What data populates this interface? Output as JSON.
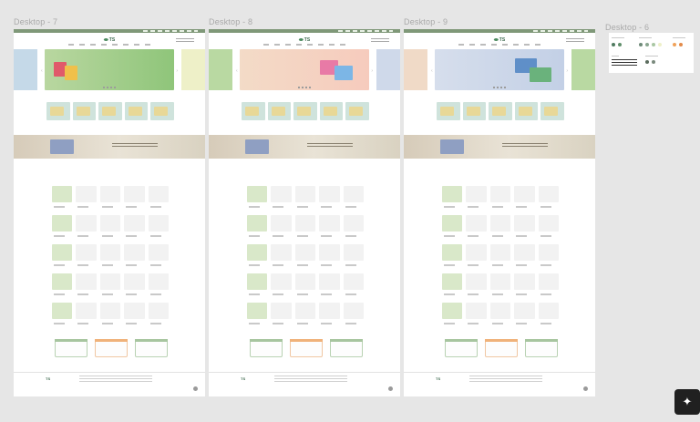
{
  "frames": [
    {
      "label": "Desktop - 7",
      "banner_line1": "",
      "banner_line2": "",
      "banner_bg": "#a8d08a",
      "banner_color": "#7dbb6a",
      "pkg_colors": [
        "#e05a6a",
        "#f0c04a",
        "#5a8bd0"
      ]
    },
    {
      "label": "Desktop - 8",
      "banner_line1": "",
      "banner_line2": "",
      "banner_bg": "#f1d9c4",
      "banner_color": "#f3c8b8",
      "pkg_colors": [
        "#e87aa6",
        "#7cb6e6",
        "#f3c36a"
      ]
    },
    {
      "label": "Desktop - 9",
      "banner_line1": "",
      "banner_line2": "",
      "banner_bg": "#cfd9e8",
      "banner_color": "#b9c8e3",
      "pkg_colors": [
        "#5f8fc8",
        "#6ab27c",
        "#4b6fa8"
      ]
    }
  ],
  "palette_frame": {
    "label": "Desktop - 6",
    "swatches": [
      "#4f7a5f",
      "#5f8f6a",
      "#6e8a78",
      "#8aa690",
      "#a9c7a3",
      "#e0b98a",
      "#f0a25a",
      "#e38b4a",
      "#5b6c5e",
      "#7a8a7d"
    ]
  },
  "colors": {
    "canvas": "#e6e6e6",
    "brand_green": "#7f9878",
    "label_gray": "#a9a9a9"
  },
  "toolbar": {
    "magic_icon": "sparkle-icon"
  }
}
